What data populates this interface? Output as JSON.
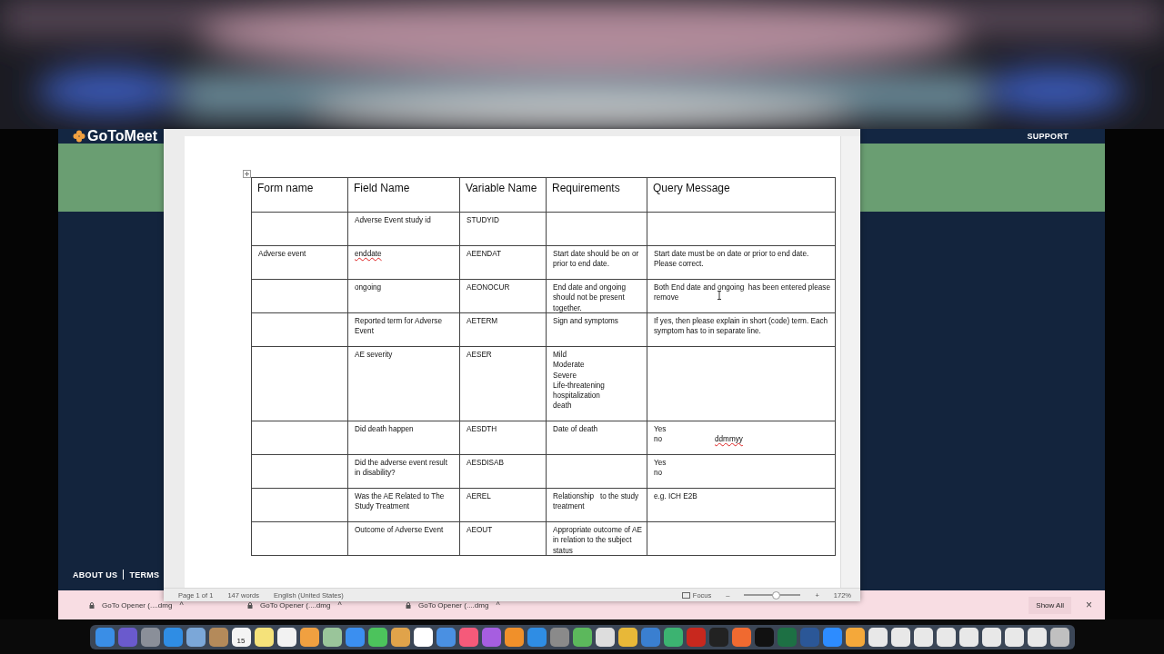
{
  "browser": {
    "logo": "GoToMeet",
    "nav_link": "SUPPORT",
    "footer_links": [
      "ABOUT US",
      "TERMS"
    ]
  },
  "document": {
    "table": {
      "columns": [
        "Form name",
        "Field Name",
        "Variable Name",
        "Requirements",
        "Query Message"
      ],
      "rows": [
        {
          "cells": [
            {
              "text": ""
            },
            {
              "text": "Adverse Event study id"
            },
            {
              "text": "STUDYID"
            },
            {
              "text": ""
            },
            {
              "text": ""
            }
          ]
        },
        {
          "cells": [
            {
              "text": "Adverse event"
            },
            {
              "text": "enddate",
              "misspelled": true
            },
            {
              "text": "AEENDAT"
            },
            {
              "text": "Start date should be on or prior to end date."
            },
            {
              "text": "Start date must be on date or prior to end date. Please correct."
            }
          ]
        },
        {
          "cells": [
            {
              "text": ""
            },
            {
              "text": "ongoing"
            },
            {
              "text": "AEONOCUR"
            },
            {
              "text": "End date and ongoing should not be present together."
            },
            {
              "text": "Both End date and ongoing  has been entered please remove",
              "caret": true
            }
          ]
        },
        {
          "cells": [
            {
              "text": ""
            },
            {
              "text": "Reported term for Adverse Event"
            },
            {
              "text": "AETERM"
            },
            {
              "text": "Sign and symptoms"
            },
            {
              "text": "If yes, then please explain in short (code) term. Each symptom has to in separate line."
            }
          ]
        },
        {
          "cells": [
            {
              "text": ""
            },
            {
              "text": "AE severity"
            },
            {
              "text": "AESER"
            },
            {
              "lines": [
                "Mild",
                "Moderate",
                "Severe",
                "Life-threatening",
                "hospitalization",
                "death"
              ]
            },
            {
              "text": ""
            }
          ]
        },
        {
          "cells": [
            {
              "text": ""
            },
            {
              "text": "Did death happen"
            },
            {
              "text": "AESDTH"
            },
            {
              "text": "Date of death"
            },
            {
              "lines": [
                "Yes",
                "no"
              ],
              "aside": {
                "text": "ddmmyy",
                "misspelled": true
              }
            }
          ]
        },
        {
          "cells": [
            {
              "text": ""
            },
            {
              "text": "Did the adverse event result in disability?"
            },
            {
              "text": "AESDISAB"
            },
            {
              "text": ""
            },
            {
              "lines": [
                "Yes",
                "no"
              ]
            }
          ]
        },
        {
          "cells": [
            {
              "text": ""
            },
            {
              "text": "Was the AE Related to The Study Treatment"
            },
            {
              "text": "AEREL"
            },
            {
              "text": "Relationship   to the study treatment"
            },
            {
              "text": "e.g. ICH E2B"
            }
          ]
        },
        {
          "cells": [
            {
              "text": ""
            },
            {
              "text": "Outcome of Adverse Event"
            },
            {
              "text": "AEOUT"
            },
            {
              "text": "Appropriate outcome of AE in relation to the subject status"
            },
            {
              "text": ""
            }
          ]
        }
      ]
    }
  },
  "status_bar": {
    "page": "Page 1 of 1",
    "words": "147 words",
    "language": "English (United States)",
    "focus": "Focus",
    "zoom_out": "–",
    "zoom_in": "+",
    "zoom": {
      "level": 0.55,
      "reading": "172%"
    }
  },
  "downloads": {
    "items": [
      {
        "name": "GoTo Opener (....dmg",
        "chevron": "^"
      },
      {
        "name": "GoTo Opener (....dmg",
        "chevron": "^"
      },
      {
        "name": "GoTo Opener (....dmg",
        "chevron": "^"
      }
    ],
    "show_all": "Show All",
    "close": "×"
  },
  "dock": {
    "apps": [
      {
        "color": "#3a8ee6"
      },
      {
        "color": "#6a5acd"
      },
      {
        "color": "#8a8f99"
      },
      {
        "color": "#2f8de4"
      },
      {
        "color": "#7ba7d8"
      },
      {
        "color": "#b48a5a"
      },
      {
        "color": "#f4f4f4",
        "date": "15"
      },
      {
        "color": "#f5e27a"
      },
      {
        "color": "#f2f2f2"
      },
      {
        "color": "#f0a040"
      },
      {
        "color": "#9ac59a"
      },
      {
        "color": "#3b8ff0"
      },
      {
        "color": "#4cc35c"
      },
      {
        "color": "#e0a34a"
      },
      {
        "color": "#ffffff"
      },
      {
        "color": "#4a90e2"
      },
      {
        "color": "#f55a7a"
      },
      {
        "color": "#a65ee0"
      },
      {
        "color": "#f0902a"
      },
      {
        "color": "#2f8de4"
      },
      {
        "color": "#8a8a8a"
      },
      {
        "color": "#5cb85c"
      },
      {
        "color": "#dddddd"
      },
      {
        "color": "#e8b838"
      },
      {
        "color": "#3a7fd0"
      },
      {
        "color": "#3cb371"
      },
      {
        "color": "#c8281e"
      },
      {
        "color": "#222222"
      },
      {
        "color": "#f06a30"
      },
      {
        "color": "#111111"
      },
      {
        "color": "#1d7044"
      },
      {
        "color": "#2b5797"
      },
      {
        "color": "#2d8cff"
      },
      {
        "color": "#f4a83a"
      },
      {
        "color": "#e8e8e8"
      },
      {
        "color": "#e8e8e8"
      },
      {
        "color": "#e8e8e8"
      },
      {
        "color": "#e8e8e8"
      },
      {
        "color": "#e8e8e8"
      },
      {
        "color": "#e8e8e8"
      },
      {
        "color": "#e8e8e8"
      },
      {
        "color": "#e8e8e8"
      },
      {
        "color": "#c0c0c0"
      }
    ]
  }
}
